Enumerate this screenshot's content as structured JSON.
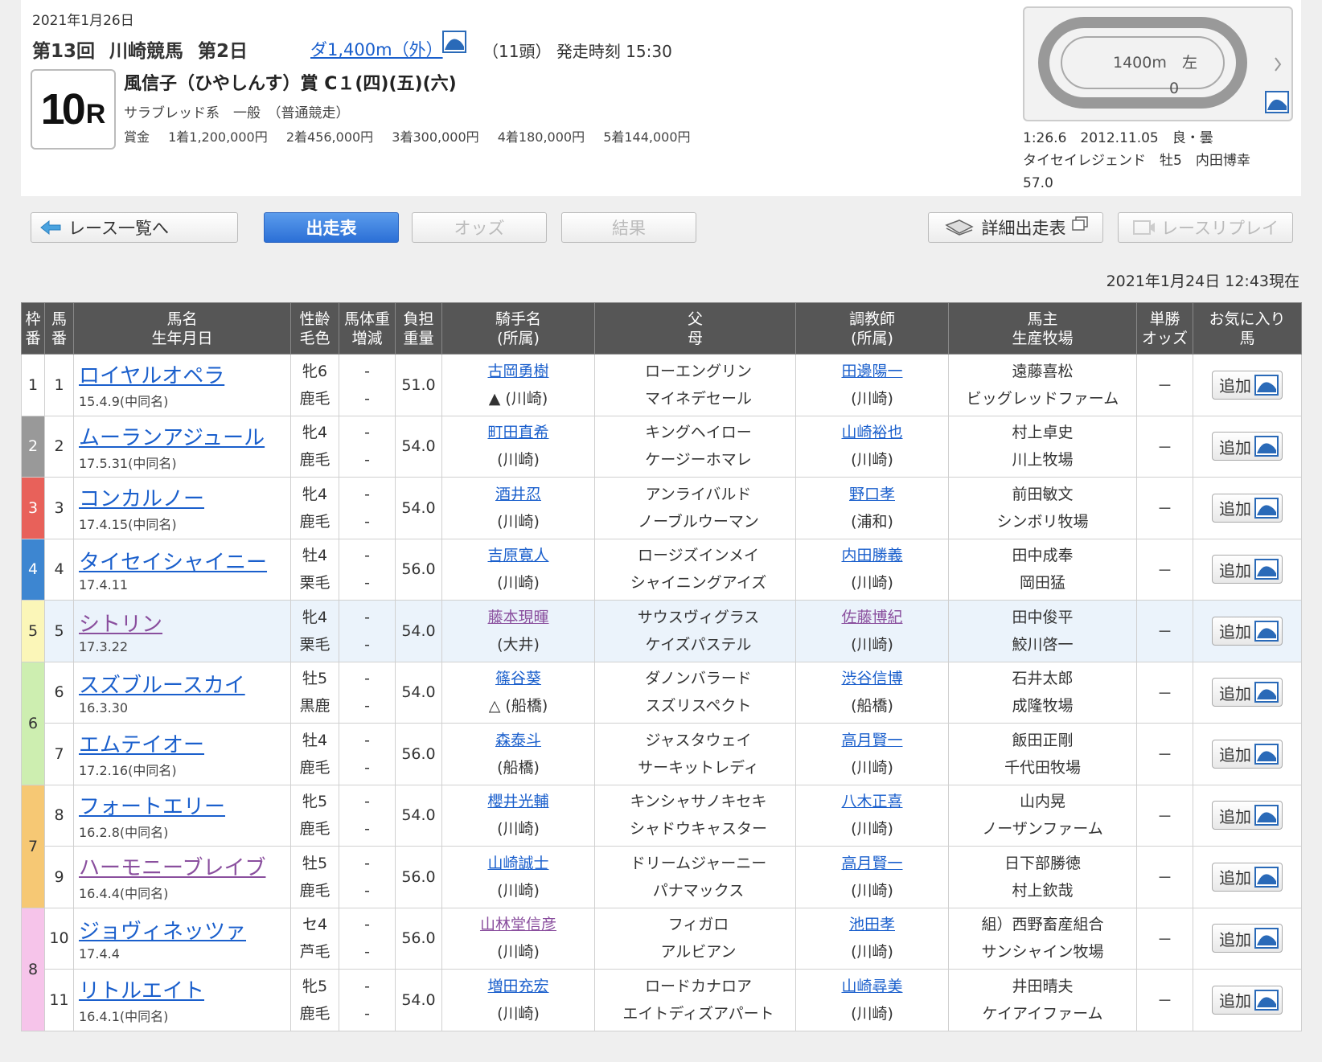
{
  "header": {
    "date": "2021年1月26日",
    "meeting": "第13回",
    "venue": "川崎競馬",
    "day": "第2日",
    "course": "ダ1,400m（外）",
    "heads": "（11頭）",
    "post_time": "発走時刻 15:30",
    "race_number": "10",
    "race_r": "R",
    "race_name": "風信子（ひやしんす）賞 C１(四)(五)(六)",
    "race_type": "サラブレッド系　一般　（普通競走）",
    "prize_label": "賞金",
    "prizes": [
      "1着1,200,000円",
      "2着456,000円",
      "3着300,000円",
      "4着180,000円",
      "5着144,000円"
    ]
  },
  "course_map": {
    "distance": "1400m",
    "direction": "左",
    "goal_mark": "0"
  },
  "record": {
    "time": "1:26.6",
    "date": "2012.11.05",
    "condition": "良・曇",
    "horse": "タイセイレジェンド",
    "sex_age": "牡5",
    "jockey": "内田博幸",
    "weight": "57.0"
  },
  "nav": {
    "back": "レース一覧へ",
    "entries": "出走表",
    "odds": "オッズ",
    "results": "結果",
    "detail": "詳細出走表",
    "replay": "レースリプレイ"
  },
  "timestamp": "2021年1月24日 12:43現在",
  "table": {
    "headers": {
      "waku": [
        "枠",
        "番"
      ],
      "umaban": [
        "馬",
        "番"
      ],
      "horse": [
        "馬名",
        "生年月日"
      ],
      "sex": [
        "性齢",
        "毛色"
      ],
      "weight": [
        "馬体重",
        "増減"
      ],
      "burden": [
        "負担",
        "重量"
      ],
      "jockey": [
        "騎手名",
        "(所属)"
      ],
      "sire": [
        "父",
        "母"
      ],
      "trainer": [
        "調教師",
        "(所属)"
      ],
      "owner": [
        "馬主",
        "生産牧場"
      ],
      "odds": [
        "単勝",
        "オッズ"
      ],
      "fav": [
        "お気に入り",
        "馬"
      ]
    },
    "add_label": "追加",
    "waku_colors": {
      "1": "#ffffff",
      "2": "#999999",
      "3": "#e8615a",
      "4": "#3d86d1",
      "5": "#fbf6b8",
      "6": "#cdeeb0",
      "7": "#f6c874",
      "8": "#f6c4ea"
    },
    "rows": [
      {
        "waku": "1",
        "umaban": "1",
        "name": "ロイヤルオペラ",
        "birth": "15.4.9(中同名)",
        "sex": "牝6",
        "color": "鹿毛",
        "weight": "-",
        "diff": "-",
        "burden": "51.0",
        "jockey": "古岡勇樹",
        "jockey_aff": "▲ (川崎)",
        "sire": "ローエングリン",
        "dam": "マイネデセール",
        "trainer": "田邊陽一",
        "trainer_aff": "(川崎)",
        "owner": "遠藤喜松",
        "breeder": "ビッグレッドファーム",
        "odds": "－"
      },
      {
        "waku": "2",
        "umaban": "2",
        "name": "ムーランアジュール",
        "birth": "17.5.31(中同名)",
        "sex": "牝4",
        "color": "鹿毛",
        "weight": "-",
        "diff": "-",
        "burden": "54.0",
        "jockey": "町田直希",
        "jockey_aff": "(川崎)",
        "sire": "キングヘイロー",
        "dam": "ケージーホマレ",
        "trainer": "山崎裕也",
        "trainer_aff": "(川崎)",
        "owner": "村上卓史",
        "breeder": "川上牧場",
        "odds": "－"
      },
      {
        "waku": "3",
        "umaban": "3",
        "name": "コンカルノー",
        "birth": "17.4.15(中同名)",
        "sex": "牝4",
        "color": "鹿毛",
        "weight": "-",
        "diff": "-",
        "burden": "54.0",
        "jockey": "酒井忍",
        "jockey_aff": "(川崎)",
        "sire": "アンライバルド",
        "dam": "ノーブルウーマン",
        "trainer": "野口孝",
        "trainer_aff": "(浦和)",
        "owner": "前田敏文",
        "breeder": "シンボリ牧場",
        "odds": "－"
      },
      {
        "waku": "4",
        "umaban": "4",
        "name": "タイセイシャイニー",
        "birth": "17.4.11",
        "sex": "牡4",
        "color": "栗毛",
        "weight": "-",
        "diff": "-",
        "burden": "56.0",
        "jockey": "吉原寛人",
        "jockey_aff": "(川崎)",
        "sire": "ロージズインメイ",
        "dam": "シャイニングアイズ",
        "trainer": "内田勝義",
        "trainer_aff": "(川崎)",
        "owner": "田中成奉",
        "breeder": "岡田猛",
        "odds": "－"
      },
      {
        "waku": "5",
        "umaban": "5",
        "name": "シトリン",
        "birth": "17.3.22",
        "sex": "牝4",
        "color": "栗毛",
        "weight": "-",
        "diff": "-",
        "burden": "54.0",
        "jockey": "藤本現暉",
        "jockey_aff": "(大井)",
        "sire": "サウスヴィグラス",
        "dam": "ケイズパステル",
        "trainer": "佐藤博紀",
        "trainer_aff": "(川崎)",
        "owner": "田中俊平",
        "breeder": "鮫川啓一",
        "odds": "－"
      },
      {
        "waku": "6",
        "umaban": "6",
        "name": "スズブルースカイ",
        "birth": "16.3.30",
        "sex": "牡5",
        "color": "黒鹿",
        "weight": "-",
        "diff": "-",
        "burden": "54.0",
        "jockey": "篠谷葵",
        "jockey_aff": "△ (船橋)",
        "sire": "ダノンバラード",
        "dam": "スズリスペクト",
        "trainer": "渋谷信博",
        "trainer_aff": "(船橋)",
        "owner": "石井太郎",
        "breeder": "成隆牧場",
        "odds": "－"
      },
      {
        "waku": "6",
        "umaban": "7",
        "name": "エムテイオー",
        "birth": "17.2.16(中同名)",
        "sex": "牡4",
        "color": "鹿毛",
        "weight": "-",
        "diff": "-",
        "burden": "56.0",
        "jockey": "森泰斗",
        "jockey_aff": "(船橋)",
        "sire": "ジャスタウェイ",
        "dam": "サーキットレディ",
        "trainer": "高月賢一",
        "trainer_aff": "(川崎)",
        "owner": "飯田正剛",
        "breeder": "千代田牧場",
        "odds": "－"
      },
      {
        "waku": "7",
        "umaban": "8",
        "name": "フォートエリー",
        "birth": "16.2.8(中同名)",
        "sex": "牝5",
        "color": "鹿毛",
        "weight": "-",
        "diff": "-",
        "burden": "54.0",
        "jockey": "櫻井光輔",
        "jockey_aff": "(川崎)",
        "sire": "キンシャサノキセキ",
        "dam": "シャドウキャスター",
        "trainer": "八木正喜",
        "trainer_aff": "(川崎)",
        "owner": "山内晃",
        "breeder": "ノーザンファーム",
        "odds": "－"
      },
      {
        "waku": "7",
        "umaban": "9",
        "name": "ハーモニーブレイブ",
        "birth": "16.4.4(中同名)",
        "sex": "牡5",
        "color": "鹿毛",
        "weight": "-",
        "diff": "-",
        "burden": "56.0",
        "jockey": "山崎誠士",
        "jockey_aff": "(川崎)",
        "sire": "ドリームジャーニー",
        "dam": "パナマックス",
        "trainer": "高月賢一",
        "trainer_aff": "(川崎)",
        "owner": "日下部勝徳",
        "breeder": "村上欽哉",
        "odds": "－"
      },
      {
        "waku": "8",
        "umaban": "10",
        "name": "ジョヴィネッツァ",
        "birth": "17.4.4",
        "sex": "セ4",
        "color": "芦毛",
        "weight": "-",
        "diff": "-",
        "burden": "56.0",
        "jockey": "山林堂信彦",
        "jockey_aff": "(川崎)",
        "sire": "フィガロ",
        "dam": "アルビアン",
        "trainer": "池田孝",
        "trainer_aff": "(川崎)",
        "owner": "組）西野畜産組合",
        "breeder": "サンシャイン牧場",
        "odds": "－"
      },
      {
        "waku": "8",
        "umaban": "11",
        "name": "リトルエイト",
        "birth": "16.4.1(中同名)",
        "sex": "牝5",
        "color": "鹿毛",
        "weight": "-",
        "diff": "-",
        "burden": "54.0",
        "jockey": "増田充宏",
        "jockey_aff": "(川崎)",
        "sire": "ロードカナロア",
        "dam": "エイトディズアパート",
        "trainer": "山崎尋美",
        "trainer_aff": "(川崎)",
        "owner": "井田晴夫",
        "breeder": "ケイアイファーム",
        "odds": "－"
      }
    ]
  }
}
